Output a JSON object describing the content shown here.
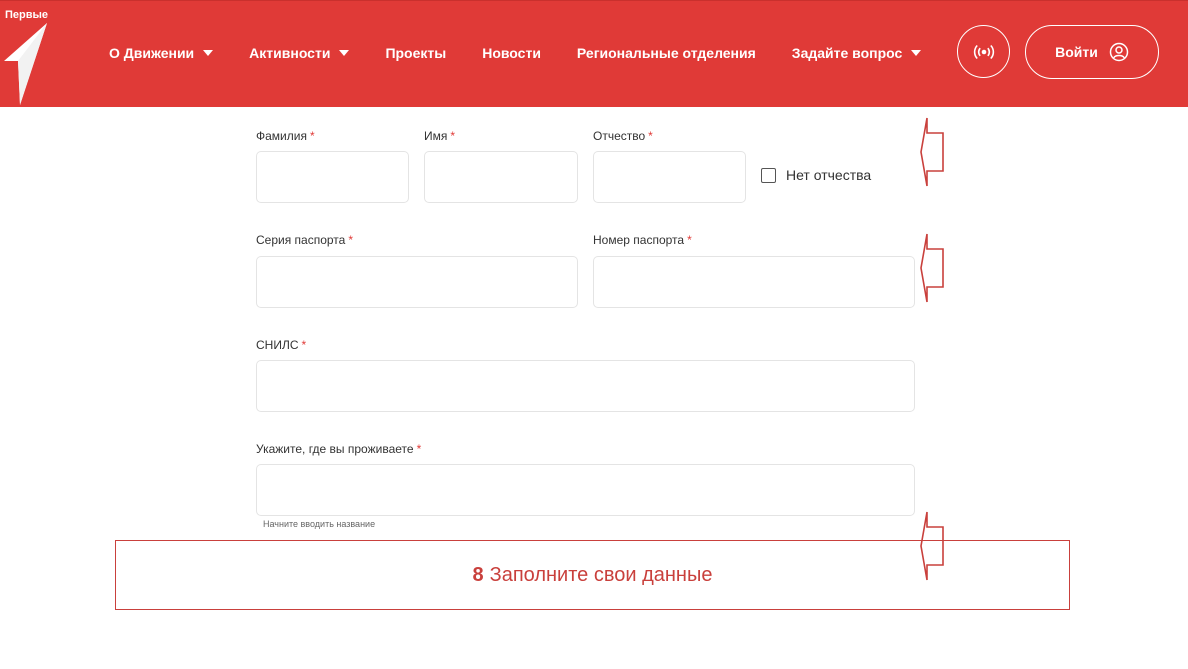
{
  "header": {
    "logo_text": "Первые",
    "nav": [
      {
        "label": "О Движении",
        "dropdown": true
      },
      {
        "label": "Активности",
        "dropdown": true
      },
      {
        "label": "Проекты",
        "dropdown": false
      },
      {
        "label": "Новости",
        "dropdown": false
      },
      {
        "label": "Региональные отделения",
        "dropdown": false
      },
      {
        "label": "Задайте вопрос",
        "dropdown": true
      }
    ],
    "broadcast_icon": "broadcast-icon",
    "login_label": "Войти",
    "login_icon": "user-circle-icon"
  },
  "form": {
    "required_mark": "*",
    "surname": {
      "label": "Фамилия",
      "value": ""
    },
    "name": {
      "label": "Имя",
      "value": ""
    },
    "patronymic": {
      "label": "Отчество",
      "value": ""
    },
    "no_patronymic": {
      "label": "Нет отчества",
      "checked": false
    },
    "passport_series": {
      "label": "Серия паспорта",
      "value": ""
    },
    "passport_number": {
      "label": "Номер паспорта",
      "value": ""
    },
    "snils": {
      "label": "СНИЛС",
      "value": ""
    },
    "residence": {
      "label": "Укажите, где вы проживаете",
      "value": "",
      "hint": "Начните вводить название"
    }
  },
  "annotation": {
    "step_number": "8",
    "text": "Заполните свои данные",
    "color": "#c9403c"
  },
  "colors": {
    "brand": "#e03a37",
    "required": "#e03a37"
  }
}
